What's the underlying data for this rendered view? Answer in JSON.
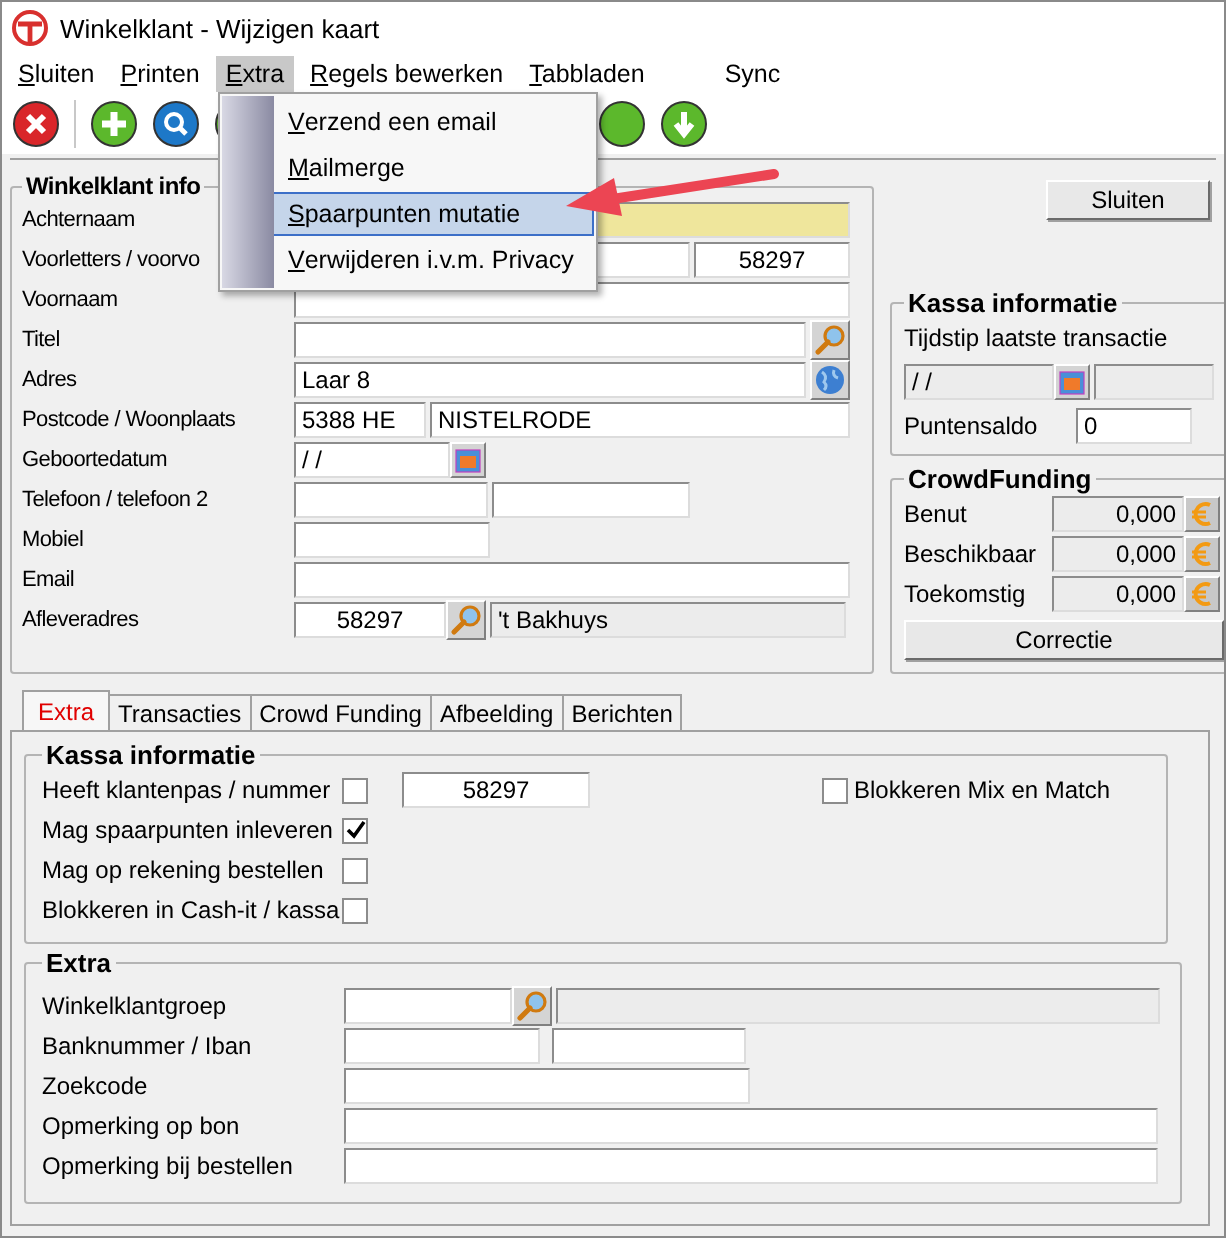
{
  "window": {
    "title": "Winkelklant - Wijzigen kaart"
  },
  "menu_bar": [
    {
      "label": "Sluiten",
      "underline_first": true,
      "selected": false
    },
    {
      "label": "Printen",
      "underline_first": true,
      "selected": false
    },
    {
      "label": "Extra",
      "underline_first": true,
      "selected": true
    },
    {
      "label": "Regels bewerken",
      "underline_first": true,
      "selected": false
    },
    {
      "label": "Tabbladen",
      "underline_first": true,
      "selected": false
    },
    {
      "label": "Sync",
      "underline_first": false,
      "selected": false
    }
  ],
  "open_menu": {
    "items": [
      {
        "label": "Verzend een email",
        "underline_first": true,
        "selected": false
      },
      {
        "label": "Mailmerge",
        "underline_first": true,
        "selected": false
      },
      {
        "label": "Spaarpunten mutatie",
        "underline_first": true,
        "selected": true
      },
      {
        "label": "Verwijderen i.v.m. Privacy",
        "underline_first": true,
        "selected": false
      }
    ]
  },
  "customer_info": {
    "title": "Winkelklant info",
    "rows": [
      {
        "label": "Achternaam",
        "kind": "highlighted"
      },
      {
        "label": "Voorletters / voorvo",
        "kind": "split3",
        "value_3": "58297"
      },
      {
        "label": "Voornaam",
        "kind": "text"
      },
      {
        "label": "Titel",
        "kind": "lookup"
      },
      {
        "label": "Adres",
        "kind": "address",
        "value": "Laar 8"
      },
      {
        "label": "Postcode / Woonplaats",
        "kind": "postcode",
        "value": "5388 HE",
        "value_2": "NISTELRODE"
      },
      {
        "label": "Geboortedatum",
        "kind": "date",
        "value": " /  /"
      },
      {
        "label": "Telefoon / telefoon 2",
        "kind": "phone"
      },
      {
        "label": "Mobiel",
        "kind": "short"
      },
      {
        "label": "Email",
        "kind": "text"
      },
      {
        "label": "Afleveradres",
        "kind": "delivery",
        "value": "58297",
        "value_2": "'t Bakhuys"
      }
    ]
  },
  "close_button": "Sluiten",
  "register_info": {
    "title": "Kassa informatie",
    "last_transaction_label": "Tijdstip laatste transactie",
    "last_transaction_date": " /  /",
    "points_label": "Puntensaldo",
    "points": "0"
  },
  "crowdfunding": {
    "title": "CrowdFunding",
    "rows": [
      {
        "label": "Benut",
        "value": "0,000"
      },
      {
        "label": "Beschikbaar",
        "value": "0,000"
      },
      {
        "label": "Toekomstig",
        "value": "0,000"
      }
    ],
    "button": "Correctie"
  },
  "tabs": [
    {
      "label": "Extra",
      "selected": true
    },
    {
      "label": "Transacties",
      "selected": false
    },
    {
      "label": "Crowd Funding",
      "selected": false
    },
    {
      "label": "Afbeelding",
      "selected": false
    },
    {
      "label": "Berichten",
      "selected": false
    }
  ],
  "register_settings": {
    "title": "Kassa informatie",
    "rows": [
      {
        "label": "Heeft klantenpas / nummer",
        "checked": false,
        "number": "58297"
      },
      {
        "label": "Mag spaarpunten inleveren",
        "checked": true
      },
      {
        "label": "Mag op rekening bestellen",
        "checked": false
      },
      {
        "label": "Blokkeren in Cash-it / kassa",
        "checked": false
      }
    ],
    "side_option": {
      "label": "Blokkeren Mix en Match",
      "checked": false
    }
  },
  "extra": {
    "title": "Extra",
    "rows": [
      {
        "label": "Winkelklantgroep",
        "kind": "lookup"
      },
      {
        "label": "Banknummer / Iban",
        "kind": "pair"
      },
      {
        "label": "Zoekcode",
        "kind": "medium"
      },
      {
        "label": "Opmerking op bon",
        "kind": "wide"
      },
      {
        "label": "Opmerking bij bestellen",
        "kind": "wide"
      }
    ]
  }
}
